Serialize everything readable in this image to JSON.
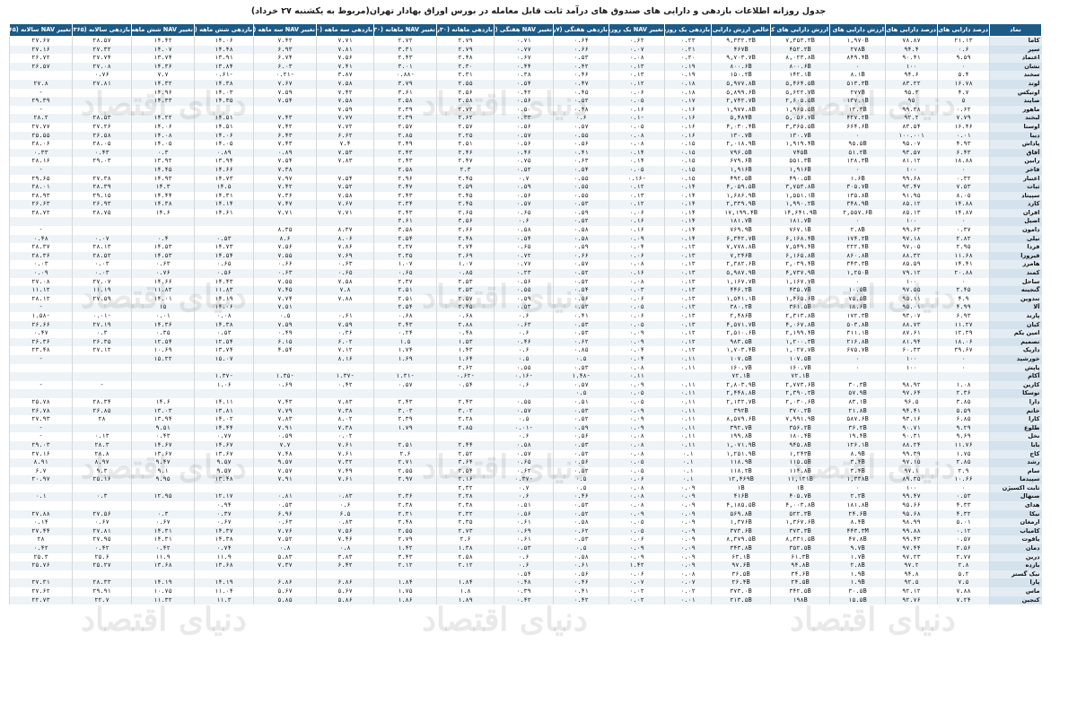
{
  "title": "جدول روزانه اطلاعات بازدهی و دارایی های صندوق های درآمد ثابت قابل معامله در بورس اوراق بهادار تهران(مربوط به یکشنبه ۲۷ خرداد)",
  "watermark": "دنیای اقتصاد",
  "headers": [
    "نماد",
    "درصد دارایی های پرریسک",
    "درصد دارایی های کم ریسک",
    "ارزش دارایی های پرریسک",
    "ارزش دارایی های کم ریسک",
    "خالص ارزش دارایی ها",
    "بازدهی یک روزه",
    "تغییر NAV یک روزه",
    "بازدهی هفتگی (۷روزه)",
    "تغییر NAV هفتگی (۷روزه)",
    "بازدهی ماهانه (۳۰روزه)",
    "تغییر NAV ماهانه (۳۰روزه)",
    "بازدهی سه ماهه (۹۰روزه)",
    "تغییر NAV سه ماهه (۹۰روزه)",
    "بازدهی شش ماهه (۱۸۰روزه)",
    "تغییر NAV شش ماهه (۱۸۰روزه)",
    "بازدهی سالانه (۳۶۵روزه)",
    "تغییر NAV سالانه (۳۶۵روزه)"
  ],
  "rows": [
    [
      "کاما",
      "۲۱.۱۳",
      "۷۸.۸۷",
      "۱,۹۷۰B",
      "۷,۳۵۳.۳B",
      "۹,۳۳۲.۳B",
      "۰.۲۳",
      "۰.۶۲",
      "۰.۶۴",
      "۰.۷۱",
      "۲.۷۹",
      "۲.۷۲",
      "۷.۷۱",
      "۷.۴۲",
      "۱۴.۰۶",
      "۱۴.۴۲",
      "۲۸.۵۷",
      "۲۷.۶۷"
    ],
    [
      "سپر",
      "۰.۶",
      "۹۴.۴",
      "۲۷۸B",
      "۴۵۲.۲B",
      "۴۶۷B",
      "۰.۲۱",
      "۰.۰۷",
      "۰.۶۶",
      "۰.۷۷",
      "۲.۷۹",
      "۳.۳۱",
      "۷.۸۱",
      "۶.۹۳",
      "۱۴.۴۸",
      "۱۴.۰۷",
      "۲۷.۳۲",
      "۲۷.۱۶"
    ],
    [
      "اعتماد",
      "۹.۵۹",
      "۹۰.۴۱",
      "۸۴۹.۴B",
      "۸,۰۲۳.۸B",
      "۹,۷۰۳.۷B",
      "۰.۲۰",
      "۰.۰۸",
      "۰.۵۳",
      "۰.۶۷",
      "۲.۴۸",
      "۲.۴۳",
      "۷.۵۶",
      "۶.۷۴",
      "۱۳.۹۱",
      "۱۳.۷۴",
      "۲۷.۷۴",
      "۲۶.۷۲"
    ],
    [
      "نشان",
      "۰",
      "۱۰۰",
      "۰",
      "۸۰۰.۶B",
      "۸۰۰.۶B",
      "۰.۱۹",
      "۰.۱۳",
      "۰.۴۲",
      "۰.۴۴",
      "۲.۳۰",
      "۳.۰۱",
      "۷.۴۱",
      "۶.۰۳",
      "۱۳.۸۴",
      "۱۴.۳۶",
      "۲۷.۰۸",
      "۲۶.۵۷"
    ],
    [
      "سخند",
      "۵.۴",
      "۹۴.۶",
      "۸.۱B",
      "۱۴۲.۱B",
      "۱۵۰.۲B",
      "۰.۱۹",
      "۰.۱۳",
      "۰.۴۶",
      "۰.۳۸",
      "۲.۳۱",
      "-۰.۸۸",
      "۳.۸۷",
      "-۰.۲۱",
      "-۰.۶۱",
      "۷.۷",
      "۰.۷۶",
      ""
    ],
    [
      "لوتد",
      "۱۶.۷۸",
      "۸۳.۲۲",
      "۵۱۳.۳B",
      "۵,۴۶۴.۵B",
      "۵,۹۷۷.۸B",
      "۰.۱۸",
      "۰.۱۲",
      "۰.۴۷",
      "۰.۵۴",
      "۲.۵۵",
      "۳.۷۹",
      "۷.۵۸",
      "۷.۶۷",
      "۱۴.۳۸",
      "۱۴.۳۲",
      "۲۷.۸۱",
      "۲۷.۸"
    ],
    [
      "اوتیکس",
      "۴.۷",
      "۹۵.۳",
      "۲۷۷B",
      "۵,۶۲۲.۷B",
      "۵,۸۹۹.۶B",
      "۰.۱۸",
      "۰.۰۶",
      "۰.۴۵",
      "۰.۴۲",
      "۲.۵۶",
      "۳.۶۱",
      "۷.۴۲",
      "۷.۵۹",
      "۱۴.۰۳",
      "۱۴.۹۶",
      "",
      "-"
    ],
    [
      "صایند",
      "۵",
      "۹۵",
      "۱۳۷.۱B",
      "۲,۶۰۵.۵B",
      "۲,۷۴۲.۷B",
      "۰.۱۷",
      "۰.۰۵",
      "۰.۵۲",
      "۰.۵۶",
      "۲.۵۸",
      "۲.۵۸",
      "۷.۵۸",
      "۷.۵۴",
      "۱۴.۳۵",
      "۱۴.۳۳",
      "",
      "۲۹.۳۹"
    ],
    [
      "ماهور",
      "۰.۶۲",
      "۹۹.۳۸",
      "۱۲.۳B",
      "۱,۹۶۵.۵B",
      "۱,۹۷۷.۸B",
      "۰.۱۶",
      "۰.۱۶",
      "۰.۴۸",
      "۰.۵۰",
      "۲.۷۲",
      "۲.۳۹",
      "۷.۵۹",
      "",
      "",
      "",
      "",
      "-"
    ],
    [
      "لبخند",
      "۷.۷۹",
      "۹۲.۲",
      "۴۲۷.۲B",
      "۵,۰۵۶.۷B",
      "۵,۴۸۴B",
      "۰.۱۶",
      "-۰.۱",
      "۰.۶",
      "۰.۳۳",
      "۲.۶۲",
      "۲.۳۹",
      "۷.۷۷",
      "۷.۴۳",
      "۱۴.۵۱",
      "۱۴.۲۲",
      "۲۸.۵۳",
      "۲۸.۲"
    ],
    [
      "اوستا",
      "۱۶.۴۶",
      "۸۳.۵۴",
      "۶۶۴.۶B",
      "۳,۳۶۵.۵B",
      "۴,۰۳۰.۴B",
      "۰.۱۶",
      "۰.۰۵",
      "۰.۵۷",
      "۰.۵۶",
      "۲.۵۷",
      "۲.۵۷",
      "۷.۷۲",
      "۷.۴۲",
      "۱۴.۵۱",
      "۱۴.۰۶",
      "۲۷.۲۶",
      "۲۷.۷۷"
    ],
    [
      "دیبا",
      "۰.۰۱",
      "۱۰۰.۰۰۱",
      "۰",
      "۱۳۰.۷B",
      "۱۳۰.۷B",
      "۰.۱۶",
      "۰.۰۸",
      "۰.۵۵",
      "۰.۵۷",
      "۲.۲۵",
      "۲.۸۵",
      "۶.۶۲",
      "۶.۴۳",
      "۱۴.۰۶",
      "۱۴.۰۸",
      "۲۶.۵۸",
      "۲۵.۵۵"
    ],
    [
      "پاداش",
      "۴.۹۳",
      "۹۵.۰۷",
      "۹۵.۵B",
      "۱,۹۱۹.۴B",
      "۲,۰۱۸.۹B",
      "۰.۱۵",
      "۰.۰۸",
      "۰.۵۶",
      "۰.۵۶",
      "۲.۵۱",
      "۲.۴۹",
      "۷.۴",
      "۷.۴۳",
      "۱۴.۰۵",
      "۱۴.۰۵",
      "۲۸.۰۵",
      "۲۸.۰۶"
    ],
    [
      "آفاق",
      "۶.۴۳",
      "۹۳.۵۷",
      "۵۱.۲B",
      "۷۴۵B",
      "۷۹۶.۵B",
      "۰.۱۵",
      "۰.۱۴",
      "۰.۴۱",
      "۰.۴۶",
      "۲.۴۶",
      "۲.۴۳",
      "۷.۵۳",
      "۰.۸۹",
      "۰.۸۹",
      "۰.۳",
      "۰.۴۳",
      "۰.۳۳"
    ],
    [
      "رابین",
      "۱۸.۸۸",
      "۸۱.۱۲",
      "۱۲۸.۳B",
      "۵۵۱.۳B",
      "۶۷۹.۶B",
      "۰.۱۵",
      "۰.۱۴",
      "۰.۶۳",
      "۰.۷۵",
      "۲.۴۷",
      "۲.۴۳",
      "۷.۸۳",
      "۷.۵۴",
      "۱۳.۹۴",
      "۱۳.۹۲",
      "۲۹.۰۳",
      "۲۸.۱۶"
    ],
    [
      "فاخر",
      "۰",
      "۱۰۰",
      "۰",
      "۱,۹۱۶B",
      "۱,۹۱۶B",
      "۰.۱۵",
      "۰.۰۵",
      "۰.۵۴",
      "۰.۵۲",
      "۲.۳",
      "۲.۵۸",
      "",
      "۷.۳۸",
      "۱۴.۶۶",
      "۱۴.۴۵",
      "",
      "-"
    ],
    [
      "اعتبار",
      "۰.۳۲",
      "۹۹.۶۸",
      "۱.۶B",
      "۴۹۰.۵B",
      "۴۹۲.۵B",
      "۰.۱۵",
      "-۰.۱۶",
      "۰.۵۵",
      "۰.۷",
      "۲.۴۵",
      "۲.۹۶",
      "۷.۵۴",
      "۷.۹۷",
      "۱۴.۷۳",
      "۱۴.۹۳",
      "۲۷.۳۸",
      "۲۹.۶۵"
    ],
    [
      "ثبات",
      "۷.۵۳",
      "۹۲.۴۷",
      "۳۰۵.۷B",
      "۳,۷۵۳.۸B",
      "۴,۰۵۹.۵B",
      "۰.۱۴",
      "۰.۱۲",
      "۰.۵۵",
      "۰.۵۹",
      "۲.۵۹",
      "۲.۴۷",
      "۷.۵۲",
      "۷.۴۲",
      "۱۴.۵",
      "۱۴.۳",
      "۲۸.۳۹",
      "۲۸.۰۱"
    ],
    [
      "سپیتاد",
      "۸.۰۵",
      "۹۱.۹۵",
      "۱۳۵.۸B",
      "۱,۵۵۱.۱B",
      "۱,۶۸۶.۹B",
      "۰.۱۴",
      "۰.۱۳",
      "۰.۵۵",
      "۰.۵۶",
      "۲.۴۵",
      "۲.۴۳",
      "۷.۵۸",
      "۷.۳۶",
      "۱۴.۳۱",
      "۱۴.۴۴",
      "۲۹.۱۵",
      "۲۸.۹۳"
    ],
    [
      "کارد",
      "۱۴.۸۸",
      "۸۵.۱۲",
      "۳۴۸.۹B",
      "۱,۹۹۰.۲B",
      "۲,۳۳۹.۹B",
      "۰.۱۴",
      "۰.۱۲",
      "۰.۵۳",
      "۰.۵۷",
      "۲.۴۵",
      "۲.۳۴",
      "۷.۶۷",
      "۷.۴۷",
      "۱۴.۱۴",
      "۱۴.۳۸",
      "۲۶.۹۳",
      "۲۶.۶۳"
    ],
    [
      "افران",
      "۱۴.۸۷",
      "۸۵.۱۳",
      "۲,۵۵۷.۶B",
      "۱۴,۶۴۱.۹B",
      "۱۷,۱۹۹.۴B",
      "۰.۱۴",
      "۰.۰۶",
      "۰.۵۹",
      "۰.۶۵",
      "۲.۶۵",
      "۲.۴۳",
      "۷.۷۱",
      "۷.۷۱",
      "۱۴.۶۱",
      "۱۴.۶",
      "۲۸.۷۵",
      "۲۸.۷۲"
    ],
    [
      "اصیل",
      "۰",
      "۱۰۰",
      "۰",
      "۱۸۱.۷B",
      "۱۸۱.۷B",
      "۰.۱۴",
      "۰.۱۶",
      "۰.۵۲",
      "۰.۶",
      "۳.۵۶",
      "۳.۶۱",
      "",
      "",
      "",
      "",
      "",
      ""
    ],
    [
      "دامون",
      "۰.۳۷",
      "۹۹.۶۳",
      "۲.۸B",
      "۷۶۷.۱B",
      "۷۶۹.۹B",
      "۰.۱۴",
      "۰.۱۶",
      "۰.۵۸",
      "۰.۵۸",
      "۲.۶۶",
      "۳.۵۸",
      "۸.۳۷",
      "۸.۳۵",
      "",
      "",
      "",
      "-"
    ],
    [
      "نیلی",
      "۲.۸۲",
      "۹۷.۱۸",
      "۱۷۴.۲B",
      "۶,۱۶۸.۴B",
      "۶,۳۴۲.۷B",
      "۰.۱۴",
      "۰.۰۹",
      "۰.۵۸",
      "۰.۵۴",
      "۲.۴۸",
      "۲.۵۴",
      "۸.۰۶",
      "۸.۶",
      "۰.۵۳",
      "۰.۴",
      "۰.۰۷",
      "۰.۴۸"
    ],
    [
      "فردا",
      "۲.۹۵",
      "۹۷.۰۵",
      "۲۲۲.۴B",
      "۷,۵۴۹.۴B",
      "۷,۷۷۸.۸B",
      "۰.۱۳",
      "۰.۰۴",
      "۰.۵۹",
      "۰.۶۵",
      "۲.۷۴",
      "۲.۲۷",
      "۷.۸۶",
      "۷.۵۶",
      "۱۴.۷۳",
      "۱۴.۵۳",
      "۲۸.۱۳",
      "۲۸.۳۷"
    ],
    [
      "فیروزا",
      "۱۱.۶۸",
      "۸۸.۳۲",
      "۸۶۰.۸B",
      "۶,۱۶۵.۸B",
      "۷,۲۴۶B",
      "۰.۱۳",
      "۰.۰۶",
      "۰.۶۶",
      "۰.۷۲",
      "۲.۶۹",
      "۲.۳۵",
      "۷.۶۹",
      "۷.۵۵",
      "۱۴.۵۴",
      "۱۴.۵۳",
      "۲۸.۵۲",
      "۲۸.۳۶"
    ],
    [
      "هامرز",
      "۱۴.۴۱",
      "۸۵.۵۹",
      "۳۴۳.۳B",
      "۲,۰۳۹.۴B",
      "۲,۳۸۲.۶B",
      "۰.۱۳",
      "۰.۰۸",
      "۰.۵۷",
      "۰.۷۷",
      "۱.۰۷",
      "۱.۰۷",
      "۰.۶۳",
      "۰.۶۶",
      "۰.۶۵",
      "۰.۶۳",
      "۰.۰۳",
      "۰.۰۳"
    ],
    [
      "کمند",
      "۲۰.۸۸",
      "۷۹.۱۲",
      "۱,۲۵۰B",
      "۴,۷۳۷.۹B",
      "۵,۹۸۷.۹B",
      "۰.۱۳",
      "۰.۱۶",
      "۰.۵۲",
      "۰.۲۳",
      "۰.۸۵",
      "۰.۶۵",
      "۰.۶۵",
      "۰.۶۳",
      "۰.۵۶",
      "۰.۷۶",
      "۰.۰۳",
      "۰.۰۹"
    ],
    [
      "ساحل",
      "۰",
      "۱۰۰",
      "۰",
      "۱,۱۶۷.۷B",
      "۱,۱۶۷.۷B",
      "۰.۱۳",
      "۰.۰۸",
      "۰.۵۲",
      "۰.۵۶",
      "۲.۵۳",
      "۲.۳۷",
      "۷.۵۸",
      "۷.۵۵",
      "۱۴.۴۳",
      "۱۴.۶۶",
      "۲۷.۰۷",
      "۲۷.۰۸"
    ],
    [
      "گنجینه",
      "۲.۴۵",
      "۹۷.۵۵",
      "۱۰.۵B",
      "۴۳۵.۷B",
      "۴۴۶.۲B",
      "۰.۱۳",
      "۰.۰۳",
      "۰.۵۴",
      "۰.۵۵",
      "۲.۵۳",
      "۲.۵۱",
      "۷.۸",
      "۷.۴۵",
      "۱۱.۸۳",
      "۱۱.۸۲",
      "۱۱.۱۹",
      "۱۱.۱۲"
    ],
    [
      "تندوین",
      "۴.۹",
      "۹۵.۱۱",
      "۷۵.۵B",
      "۱,۴۶۵.۶B",
      "۱,۵۴۱.۱B",
      "۰.۱۳",
      "۰.۰۶",
      "۰.۵۶",
      "۰.۵۹",
      "۲.۵۷",
      "۲.۵۱",
      "۷.۸۸",
      "۷.۷۴",
      "۱۴.۱۹",
      "۱۴.۰۱",
      "۲۷.۵۹",
      "۲۸.۱۲"
    ],
    [
      "آلا",
      "۴.۹۹",
      "۹۵.۰۱",
      "۱۸.۶B",
      "۳۶۱.۵B",
      "۳۸۰.۲B",
      "۰.۱۳",
      "۰.۰۵",
      "۰.۵۳",
      "۰.۵۳",
      "۲.۴۵",
      "۲.۵۴",
      "",
      "۷.۵۱",
      "۱۴.۰۶",
      "۱۵",
      "",
      "-"
    ],
    [
      "پارند",
      "۶.۹۳",
      "۹۳.۰۷",
      "۱۷۲.۳B",
      "۲,۳۱۳.۸B",
      "۲,۴۸۶B",
      "۰.۱۳",
      "۰.۰۶",
      "۰.۴۱",
      "۰.۶",
      "۰.۶۸",
      "۰.۶۸",
      "۰.۶۱",
      "۰.۵",
      "۰.۰۸",
      "۰.۰۱",
      "-۰.۰۱",
      "-۱.۵۸"
    ],
    [
      "کیان",
      "۱۱.۲۷",
      "۸۸.۷۳",
      "۵۰۳.۸B",
      "۴,۰۶۷.۸B",
      "۴,۵۷۱.۷B",
      "۰.۱۳",
      "۰.۰۵",
      "۰.۵۳",
      "۰.۶۳",
      "۲.۸۸",
      "۲.۴۳",
      "۷.۵۹",
      "۷.۵۹",
      "۱۴.۳۸",
      "۱۴.۳۶",
      "۲۷.۱۹",
      "۲۶.۶۶"
    ],
    [
      "امین یکم",
      "۱۲.۳۹",
      "۸۷.۶۱",
      "۳۱۱.۱B",
      "۲,۱۹۹.۴B",
      "۲,۵۱۰.۶B",
      "۰.۱۲",
      "۰.۰۹",
      "۰.۵۳",
      "۰.۶",
      "۰.۴۸",
      "۰.۲۴",
      "۰.۳۶",
      "۰.۴۹",
      "۰.۵۳",
      "۰.۳۵",
      "۰.۳",
      "۰.۴۷"
    ],
    [
      "تصمیم",
      "۱۸.۰۶",
      "۸۱.۹۴",
      "۲۱۶.۸B",
      "۱,۲۰۰.۳B",
      "۹۸۳.۵B",
      "۰.۱۲",
      "۰.۰۹",
      "۰.۶۲",
      "۰.۴۶",
      "۱.۵۳",
      "۱.۵",
      "۶.۰۲",
      "۶.۱۵",
      "۱۲.۵۴",
      "۱۲.۵۴",
      "۲۶.۳۵",
      "۲۶.۳۶"
    ],
    [
      "داریک",
      "۳۹.۶۷",
      "۶۰.۳۳",
      "۶۷۵.۷B",
      "۱,۰۲۷.۷B",
      "۱,۷۰۳.۴B",
      "۰.۱۲",
      "۰.۰۴",
      "۰.۸۵",
      "۰.۶",
      "۱.۴۳",
      "۱.۷۴",
      "۷.۱۲",
      "۴.۵۴",
      "۱۳.۷۴",
      "۱۰.۶۹",
      "۲۷.۱۲",
      "۲۳.۴۸"
    ],
    [
      "خورشید",
      "۰",
      "۱۰۰",
      "۰",
      "۱۰۷.۵B",
      "۱۰۷.۵B",
      "۰.۱۱",
      "۰.۰۴",
      "۰.۵",
      "۰.۵",
      "۱.۶۴",
      "۱.۶۹",
      "۸.۱۶",
      "",
      "۱۵.۰۷",
      "۱۵.۲۲",
      "",
      "-"
    ],
    [
      "پاپش",
      "۰",
      "۱۰۰",
      "۰",
      "۱۶۰.۷B",
      "۱۶۰.۷B",
      "۰.۱۱",
      "۰.۰۸",
      "۰.۵۳",
      "۰.۵۵",
      "۲.۶۲",
      "",
      "",
      "",
      "",
      "",
      "",
      ""
    ],
    [
      "آکام",
      "",
      "",
      "",
      "۷۲.۱B",
      "۷۲.۱B",
      "",
      "۰.۱۱",
      "-۱.۴۸",
      "-۰.۱۶",
      "-۰.۶۲",
      "-۱.۳۱",
      "-۱.۳۷",
      "-۱.۳۵",
      "-۱.۳۷",
      "",
      "",
      ""
    ],
    [
      "کارین",
      "۱.۰۸",
      "۹۸.۹۲",
      "۳۰.۳B",
      "۲,۷۷۳.۶B",
      "۲,۸۰۳.۹B",
      "۰.۱۱",
      "۰.۰۹",
      "۰.۵۷",
      "۰.۶",
      "۰.۵۴",
      "۰.۵۷",
      "۰.۴۲",
      "۰.۶۹",
      "۱.۰۶",
      "",
      "-",
      "-"
    ],
    [
      "توسکا",
      "۲.۳۶",
      "۹۷.۶۴",
      "۵۷.۹B",
      "۲,۳۹۰.۲B",
      "۲,۴۴۸.۸B",
      "۰.۱۱",
      "۰.۰۵",
      "۰.۵",
      "",
      "",
      "",
      "",
      "",
      "",
      "",
      "",
      ""
    ],
    [
      "دارا",
      "۳.۸۵",
      "۹۶.۵",
      "۸۳.۱B",
      "۲,۰۳۰.۶B",
      "۲,۱۳۲.۷B",
      "۰.۱۱",
      "۰.۰۵",
      "۰.۵۱",
      "۰.۵۵",
      "۲.۴۳",
      "۲.۴۳",
      "۷.۸۳",
      "۷.۴۳",
      "۱۴.۱۱",
      "۱۴.۶",
      "۲۸.۳۴",
      "۲۵.۷۸"
    ],
    [
      "خاتم",
      "۵.۵۹",
      "۹۴.۴۱",
      "۲۱.۸B",
      "۳۷۰.۲B",
      "۳۹۲B",
      "۰.۱۱",
      "۰.۰۹",
      "۰.۵۳",
      "۰.۵۷",
      "۳.۰۲",
      "۳.۰۳",
      "۷.۳۸",
      "۷.۷۹",
      "۱۳.۸۱",
      "۱۳.۰۳",
      "۲۶.۸۵",
      "۲۶.۷۸"
    ],
    [
      "کارا",
      "۶.۸۵",
      "۹۳.۱۶",
      "۵۸۷.۶B",
      "۷,۹۹۱.۹B",
      "۸,۵۷۹.۶B",
      "۰.۱۱",
      "۰.۰۹",
      "۰.۵۲",
      "۰.۵",
      "۲.۲۸",
      "۲.۳۹",
      "۸.۰۲",
      "۷.۸۳",
      "۱۴.۰۲",
      "۱۳.۹۴",
      "۲۸",
      "۲۷.۹۳"
    ],
    [
      "طلوع",
      "۹.۲۹",
      "۹۰.۷۱",
      "۳۶.۲B",
      "۳۵۶.۲B",
      "۳۹۲.۷B",
      "۰.۱۱",
      "۰.۰۹",
      "۰.۵۹",
      "-۰.۰۱",
      "۲.۸۵",
      "۱.۷۹",
      "۷.۳۸",
      "۷.۹۱",
      "۱۴.۴۴",
      "۹.۵۱",
      "",
      "-"
    ],
    [
      "نخل",
      "۹.۶۹",
      "۹۰.۳۱",
      "۱۹.۴B",
      "۱۸۰.۴B",
      "۱۹۹.۸B",
      "۰.۱۱",
      "۰.۰۸",
      "۰.۵۶",
      "۰.۶",
      "",
      "",
      "۰.۰۲",
      "۰.۵۹",
      "۰.۷۷",
      "۰.۴۳",
      "۰.۱۳",
      "-"
    ],
    [
      "بابا",
      "۱۱.۷۶",
      "۸۸.۲۴",
      "۱۲۶.۱B",
      "۹۴۵.۸B",
      "۱,۰۷۱.۹B",
      "۰.۱۱",
      "۰.۰۸",
      "۰.۵۳",
      "۰.۵۸",
      "۲.۴۴",
      "۲.۵۱",
      "۷.۶۱",
      "۷.۷",
      "۱۴.۶۷",
      "۱۴.۶۷",
      "۲۸.۳",
      "۲۹.۰۳"
    ],
    [
      "کاج",
      "۱.۷۵",
      "۹۹.۳۹",
      "۸.۹B",
      "۱,۲۴۳B",
      "۱,۲۵۱.۹B",
      "۰.۱",
      "۰.۰۸",
      "۰.۵۲",
      "۰.۵۷",
      "۲.۵۲",
      "۲.۶",
      "۷.۶۱",
      "۷.۴۸",
      "۱۳.۶۷",
      "۱۳.۶۷",
      "۲۸.۸",
      "۲۷.۱۶"
    ],
    [
      "رشد",
      "۲.۸۵",
      "۹۷.۱۵",
      "۳.۴B",
      "۱۱۵.۵B",
      "۱۱۸.۹B",
      "۰.۱",
      "۰.۰۵",
      "۰.۵۶",
      "۰.۶۵",
      "۳.۶۴",
      "۲.۷۱",
      "۷.۳۲",
      "۹.۵۷",
      "۹.۵۷",
      "۹.۴۷",
      "۸.۹۷",
      "۸.۹۱"
    ],
    [
      "سام",
      "۲.۹",
      "۹۷.۱",
      "۳.۴B",
      "۱۱۴.۸B",
      "۱۱۸.۲B",
      "۰.۱",
      "۰.۰۵",
      "۰.۵۲",
      "۰.۶۲",
      "۲.۵۴",
      "۲.۵۵",
      "۷.۴۹",
      "۷.۵۷",
      "۹.۵۷",
      "۹.۱",
      "۹.۳",
      "۶.۷"
    ],
    [
      "سپیدما",
      "۱۰.۶۶",
      "۸۹.۳۵",
      "۱,۳۳۸B",
      "۱۱,۱۳۱B",
      "۱۲,۴۶۹B",
      "۰.۱",
      "۰.۰۶",
      "۰.۵",
      "-۰.۳۷",
      "۲.۱۶",
      "۲.۹۷",
      "۷.۶۱",
      "۷.۹۱",
      "۱۳.۴۸",
      "۹.۹۵",
      "۲۵.۱۶",
      "۲۰.۹۷"
    ],
    [
      "ثابت اکسیژن",
      "۰",
      "۱۰۰",
      "۰",
      "۱B",
      "۱B",
      "۰.۰۹",
      "۰.۰۸",
      "۰.۵",
      "۰.۷",
      "۲.۳۲",
      "",
      "",
      "",
      "",
      "",
      "",
      ""
    ],
    [
      "صنهال",
      "۰.۵۳",
      "۹۹.۴۷",
      "۲.۲B",
      "۴۰۵.۷B",
      "۴۱۶B",
      "۰.۰۹",
      "۰.۰۸",
      "۰.۴۶",
      "۰.۶",
      "۲.۲۸",
      "۲.۳۶",
      "۰.۸۳",
      "۰.۸۱",
      "۱۲.۱۷",
      "۱۲.۹۵",
      "۰.۳",
      "۰.۱"
    ],
    [
      "هدای",
      "۴.۳۳",
      "۹۵.۶۶",
      "۱۸۱.۸B",
      "۴,۰۰۳.۸B",
      "۴,۱۸۵.۵B",
      "۰.۰۹",
      "۰.۰۸",
      "۰.۵۳",
      "۰.۵۱",
      "۲.۳۸",
      "۲.۳۸",
      "۰.۶",
      "۰.۵۳",
      "۰.۹۴",
      "",
      "",
      ""
    ],
    [
      "نیکا",
      "۴.۳۲",
      "۹۵.۶۸",
      "۲۴.۶B",
      "۵۲۲.۳B",
      "۵۶۹.۸B",
      "۰.۰۹",
      "۰.۰۹",
      "۰.۵۲",
      "۰.۵۶",
      "۲.۳۲",
      "۲.۳۱",
      "۶.۵",
      "۶.۹۶",
      "۰.۳۷",
      "۰.۳",
      "۲۷.۵۶",
      "۲۷.۸۸"
    ],
    [
      "ارمغان",
      "۵.۰۱",
      "۹۸.۹۹",
      "۸.۴B",
      "۱,۳۶۷.۶B",
      "۱,۳۷۶B",
      "۰.۰۹",
      "۰.۰۵",
      "۰.۵۸",
      "۰.۶۱",
      "۲.۳۵",
      "۲.۴۸",
      "۰.۸۳",
      "۰.۶۳",
      "۰.۶۷",
      "۰.۶۷",
      "۰.۶۷",
      "۰.۱۴"
    ],
    [
      "کامیاب",
      "۰.۱۲",
      "۹۹.۸۸",
      "۴۴۳.۳M",
      "۳۷۳.۳B",
      "۳۷۳.۶B",
      "۰.۰۹",
      "۰.۰۵",
      "۰.۶۲",
      "۰.۶۹",
      "۲.۷۳",
      "۲.۵۵",
      "۷.۵۶",
      "۷.۷۶",
      "۱۴.۳۷",
      "۱۴.۳۱",
      "۲۷.۸۱",
      "۲۷.۴۴"
    ],
    [
      "یاقوت",
      "۰.۵۷",
      "۹۹.۴۳",
      "۴۷.۸B",
      "۸,۳۳۱.۵B",
      "۸,۳۷۹.۵B",
      "۰.۰۹",
      "۰.۰۶",
      "۰.۵۳",
      "۰.۶۱",
      "۲.۶",
      "۲.۷۹",
      "۷.۴۶",
      "۷.۵۲",
      "۱۴.۳۸",
      "۱۴.۳۱",
      "۲۷.۹۵",
      "۲۸"
    ],
    [
      "دمان",
      "۲.۵۶",
      "۹۷.۴۴",
      "۹.۷B",
      "۳۵۲.۵B",
      "۳۴۳.۸B",
      "۰.۰۹",
      "۰.۰۹",
      "۰.۵",
      "۰.۵۳",
      "۱.۳۸",
      "۱.۴۲",
      "۰.۸",
      "۰.۸",
      "۰.۷۴",
      "۰.۴۲",
      "۰.۴۲",
      "۰.۴۲"
    ],
    [
      "درین",
      "۲.۷۷",
      "۹۷.۲۳",
      "۱.۷B",
      "۶۱.۳B",
      "۶۳.۱B",
      "۰.۰۹",
      "۰.۰۹",
      "۰.۵۸",
      "۰.۶",
      "۲.۵۸",
      "۳.۴۳",
      "۳.۸۳",
      "۵.۸۳",
      "۱۱.۹",
      "۱۱.۹",
      "۲۵.۶",
      "۲۵.۳"
    ],
    [
      "بازده",
      "۲.۸",
      "۹۷.۲",
      "۲.۸B",
      "۹۴.۸B",
      "۹۷.۶B",
      "۰.۰۹",
      "۱.۴۲",
      "۰.۶۱",
      "۰.۶",
      "۲.۱۲",
      "۲.۱۲",
      "۶.۴۲",
      "۷.۳۷",
      "۱۳.۶۸",
      "۱۳.۶۸",
      "۲۵.۲۷",
      "۲۵.۷۶"
    ],
    [
      "نیک گستر",
      "۵.۲",
      "۹۴.۸",
      "۱.۹B",
      "۳۴.۶B",
      "۳۶.۵B",
      "۰.۰۸",
      "۰.۰۶",
      "۰.۵۶",
      "۰.۵۴",
      "",
      "",
      "",
      "",
      "",
      "",
      "",
      ""
    ],
    [
      "پارا",
      "۷.۵",
      "۹۲.۵",
      "۱.۹B",
      "۲۴.۵B",
      "۲۶.۴B",
      "۰.۰۷",
      "۰.۰۷",
      "۰.۴۶",
      "۰.۴۸",
      "۱.۸۴",
      "۱.۸۴",
      "۶.۸۶",
      "۶.۸۶",
      "۱۴.۱۹",
      "۱۴.۱۹",
      "۲۸.۳۳",
      "۲۷.۳۱"
    ],
    [
      "ماس",
      "۷.۸۸",
      "۹۲.۱۲",
      "۳۰.۵B",
      "۳۴۲.۵B",
      "۳۷۳.۰B",
      "۰.۰۲",
      "۰.۰۲",
      "۰.۴۱",
      "۰.۳۹",
      "۱.۸",
      "۱.۷۵",
      "۵.۶۷",
      "۵.۶۷",
      "۱۱.۰۴",
      "۱۰.۷۵",
      "۲۹.۹۱",
      "۲۷.۶۲"
    ],
    [
      "کنجین",
      "۷.۲۴",
      "۹۲.۷۶",
      "۱۵.۵B",
      "۱۹۸B",
      "۲۱۳.۵B",
      "۰.۰۱",
      "۰.۰۲",
      "۰.۴۲",
      "۰.۴۲",
      "۱.۸۹",
      "۱.۸۶",
      "۵.۸۶",
      "۵.۸۵",
      "۱۱.۳",
      "۱۱.۳۲",
      "۲۲.۷",
      "۲۲.۷۳"
    ]
  ]
}
